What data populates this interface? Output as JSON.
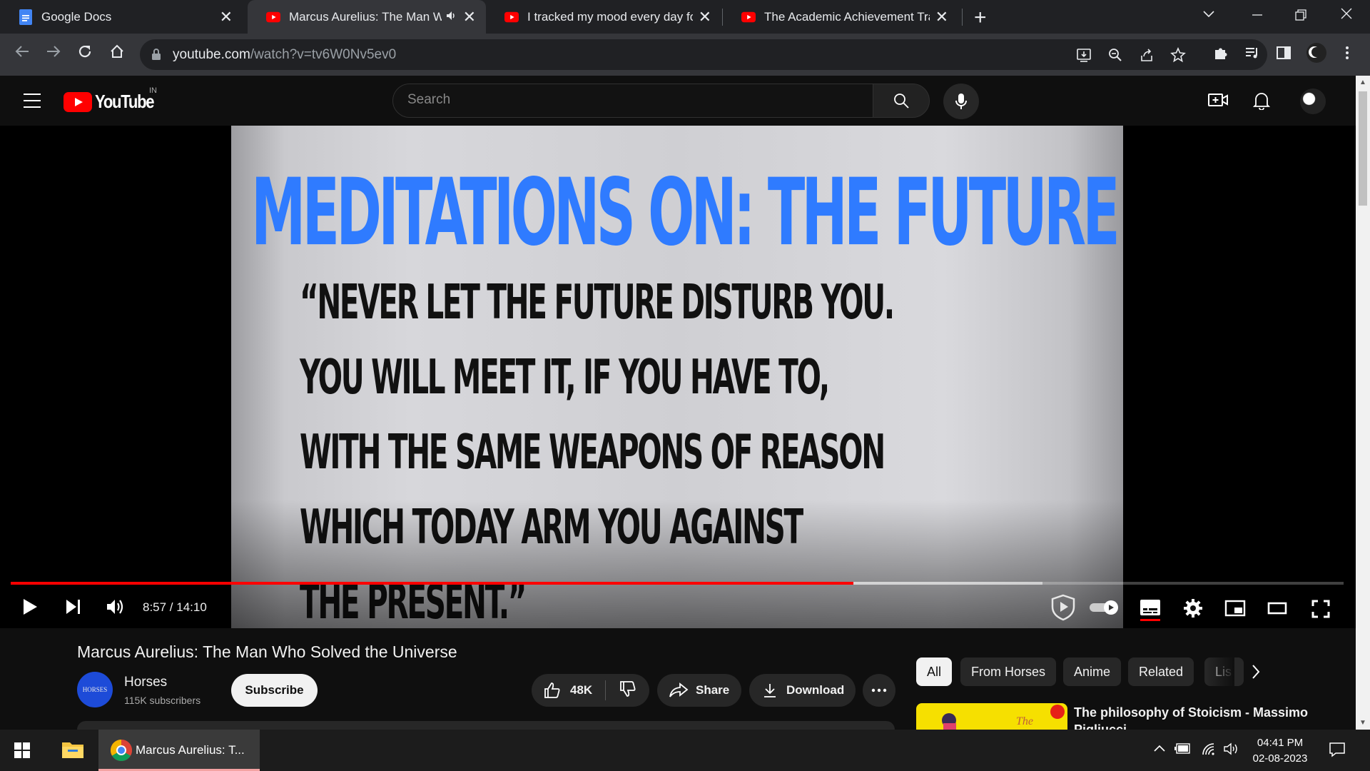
{
  "browser": {
    "tabs": [
      {
        "title": "Google Docs",
        "favicon": "google-docs-icon",
        "active": false
      },
      {
        "title": "Marcus Aurelius: The Man W",
        "favicon": "youtube-icon",
        "active": true,
        "audio": true
      },
      {
        "title": "I tracked my mood every day for",
        "favicon": "youtube-icon",
        "active": false
      },
      {
        "title": "The Academic Achievement Trap",
        "favicon": "youtube-icon",
        "active": false
      }
    ],
    "url_host": "youtube.com",
    "url_path": "/watch?v=tv6W0Nv5ev0"
  },
  "youtube": {
    "logo_text": "YouTube",
    "country": "IN",
    "search_placeholder": "Search"
  },
  "video": {
    "frame_title": "MEDITATIONS ON: THE FUTURE",
    "frame_quote": "“NEVER LET THE FUTURE DISTURB YOU.\nYOU WILL MEET IT, IF YOU HAVE TO,\nWITH THE SAME WEAPONS OF REASON\nWHICH TODAY ARM YOU AGAINST\nTHE PRESENT.”",
    "time_display": "8:57 / 14:10",
    "progress_fraction": 0.632,
    "buffer_fraction": 0.774,
    "title": "Marcus Aurelius: The Man Who Solved the Universe"
  },
  "channel": {
    "avatar_text": "HORSES",
    "name": "Horses",
    "subscribers": "115K subscribers",
    "subscribe_label": "Subscribe"
  },
  "actions": {
    "likes": "48K",
    "share_label": "Share",
    "download_label": "Download"
  },
  "chips": [
    "All",
    "From Horses",
    "Anime",
    "Related",
    "Lis"
  ],
  "recommendation": {
    "title": "The philosophy of Stoicism - Massimo Pigliucci"
  },
  "taskbar": {
    "chrome_label": "Marcus Aurelius: T...",
    "time": "04:41 PM",
    "date": "02-08-2023"
  },
  "colors": {
    "youtube_red": "#ff0000",
    "title_blue": "#2f7bff",
    "tab_bg": "#202124",
    "toolbar_bg": "#35363a"
  }
}
